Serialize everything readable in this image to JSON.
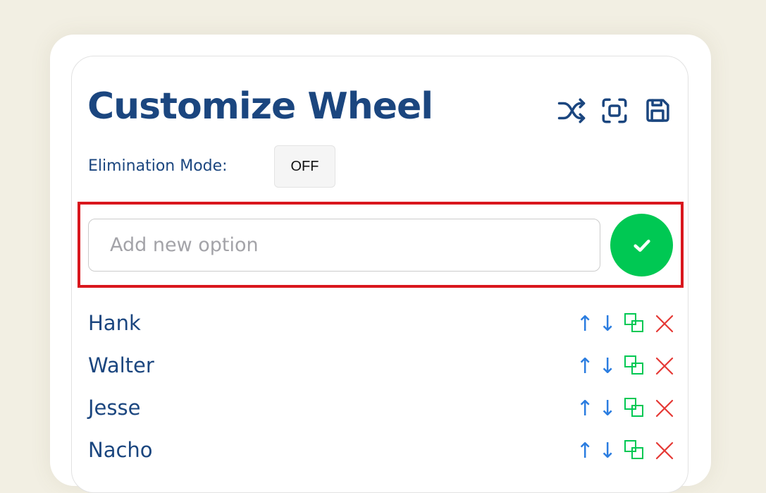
{
  "panel": {
    "title": "Customize Wheel"
  },
  "toolbar": {
    "shuffle_icon": "shuffle-icon",
    "fullscreen_icon": "fullscreen-icon",
    "save_icon": "save-icon",
    "icon_color": "#1b467f"
  },
  "elimination": {
    "label": "Elimination Mode:",
    "value": "OFF"
  },
  "add_option": {
    "value": "",
    "placeholder": "Add new option",
    "submit_icon": "check-icon",
    "submit_color": "#00c853"
  },
  "options": [
    {
      "name": "Hank"
    },
    {
      "name": "Walter"
    },
    {
      "name": "Jesse"
    },
    {
      "name": "Nacho"
    }
  ],
  "row_actions": {
    "move_up": "↑",
    "move_down": "↓",
    "duplicate_icon": "duplicate-icon",
    "delete_icon": "close-icon"
  },
  "colors": {
    "background": "#f2efe3",
    "primary": "#1b467f",
    "arrow": "#2b7de0",
    "duplicate": "#00c853",
    "delete": "#e53935",
    "highlight": "#d9171d"
  }
}
